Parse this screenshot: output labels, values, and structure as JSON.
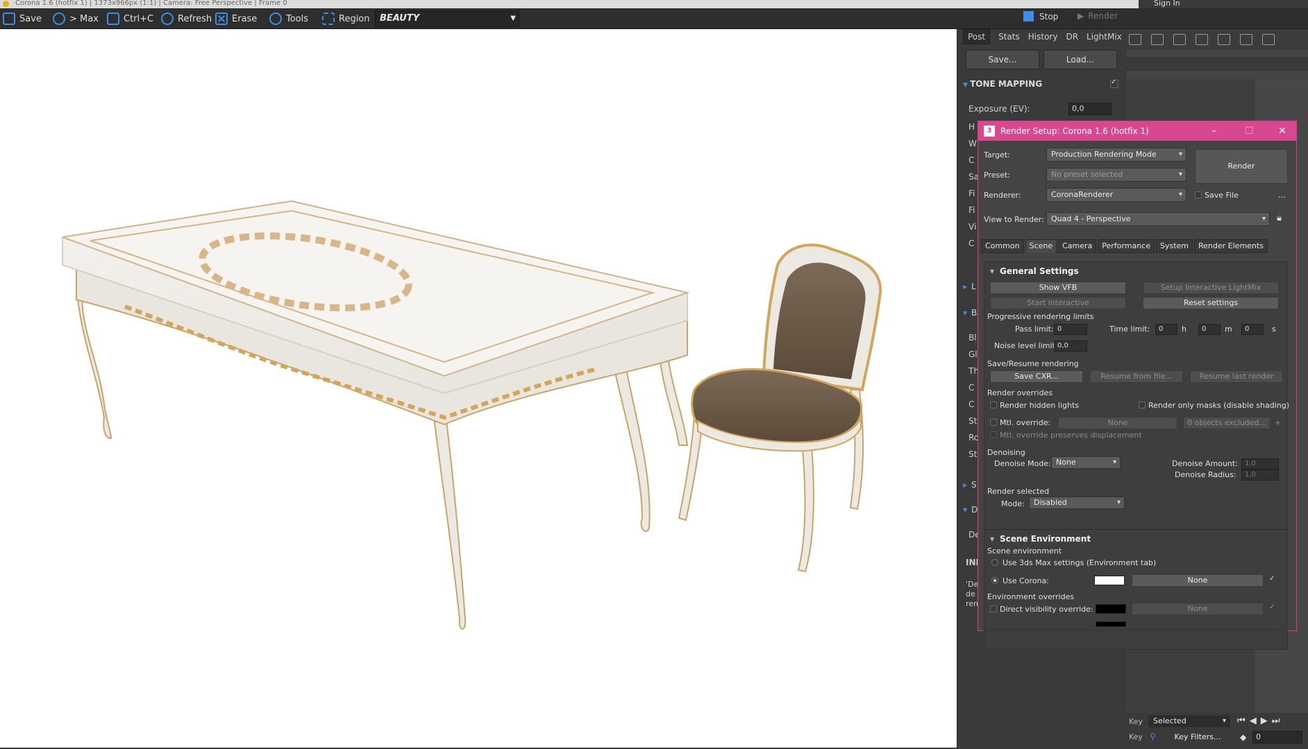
{
  "titlebar": {
    "text": "Corona 1.6 (hotfix 1) | 1373x966px (1:1) | Camera: Free Perspective | Frame 0",
    "sign_in": "Sign In"
  },
  "toolbar": {
    "save": "Save",
    "to_max": "> Max",
    "copy": "Ctrl+C",
    "refresh": "Refresh",
    "erase": "Erase",
    "tools": "Tools",
    "region": "Region",
    "channel": "BEAUTY",
    "stop": "Stop",
    "render": "Render"
  },
  "vfb_panel": {
    "tabs": [
      "Post",
      "Stats",
      "History",
      "DR",
      "LightMix"
    ],
    "save_btn": "Save...",
    "load_btn": "Load...",
    "tone_mapping": "TONE MAPPING",
    "exposure_label": "Exposure (EV):",
    "exposure_value": "0,0",
    "side_letters": [
      "H",
      "W",
      "C",
      "Sa",
      "Fi",
      "Fi",
      "Vi",
      "C",
      "L",
      "B",
      "Bl",
      "Gl",
      "Th",
      "C",
      "C",
      "St",
      "Ro",
      "St",
      "S",
      "D",
      "De",
      "INF",
      "'De",
      "de",
      "ren"
    ]
  },
  "dialog": {
    "title": "Render Setup: Corona 1.6 (hotfix 1)",
    "app_icon": "3",
    "target_label": "Target:",
    "target_value": "Production Rendering Mode",
    "preset_label": "Preset:",
    "preset_value": "No preset selected",
    "renderer_label": "Renderer:",
    "renderer_value": "CoronaRenderer",
    "save_file": "Save File",
    "more": "...",
    "view_label": "View to Render:",
    "view_value": "Quad 4 - Perspective",
    "render_btn": "Render",
    "tabs": [
      "Common",
      "Scene",
      "Camera",
      "Performance",
      "System",
      "Render Elements"
    ],
    "general": {
      "header": "General Settings",
      "show_vfb": "Show VFB",
      "setup_lightmix": "Setup Interactive LightMix",
      "start_interactive": "Start interactive",
      "reset_settings": "Reset settings",
      "progressive_title": "Progressive rendering limits",
      "pass_limit_label": "Pass limit:",
      "pass_limit": "0",
      "time_limit_label": "Time limit:",
      "time_h": "0",
      "time_m": "0",
      "time_s": "0",
      "unit_h": "h",
      "unit_m": "m",
      "unit_s": "s",
      "noise_label": "Noise level limit:",
      "noise_value": "0,0",
      "save_resume_title": "Save/Resume rendering",
      "save_cxr": "Save CXR...",
      "resume_file": "Resume from file...",
      "resume_last": "Resume last render",
      "overrides_title": "Render overrides",
      "render_hidden_lights": "Render hidden lights",
      "render_only_masks": "Render only masks (disable shading)",
      "mtl_override": "Mtl. override:",
      "mtl_none": "None",
      "objects_excluded": "0 objects excluded...",
      "plus": "+",
      "mtl_preserves": "Mtl. override preserves displacement",
      "denoising_title": "Denoising",
      "denoise_mode_label": "Denoise Mode:",
      "denoise_mode": "None",
      "denoise_amount_label": "Denoise Amount:",
      "denoise_amount": "1,0",
      "denoise_radius_label": "Denoise Radius:",
      "denoise_radius": "1,0",
      "render_selected_title": "Render selected",
      "mode_label": "Mode:",
      "mode_value": "Disabled"
    },
    "environment": {
      "header": "Scene Environment",
      "scene_env_title": "Scene environment",
      "use_3dsmax": "Use 3ds Max settings (Environment tab)",
      "use_corona": "Use Corona:",
      "none_map": "None",
      "overrides_title": "Environment overrides",
      "direct_visibility": "Direct visibility override:",
      "direct_none": "None"
    }
  },
  "anim": {
    "key1": "Key",
    "selected": "Selected",
    "key2": "Key",
    "key_filters": "Key Filters...",
    "frame": "0"
  },
  "colors": {
    "accent_blue": "#3d8ee6",
    "dialog_title": "#d8478f",
    "swatch_white": "#ffffff",
    "swatch_black": "#000000"
  }
}
